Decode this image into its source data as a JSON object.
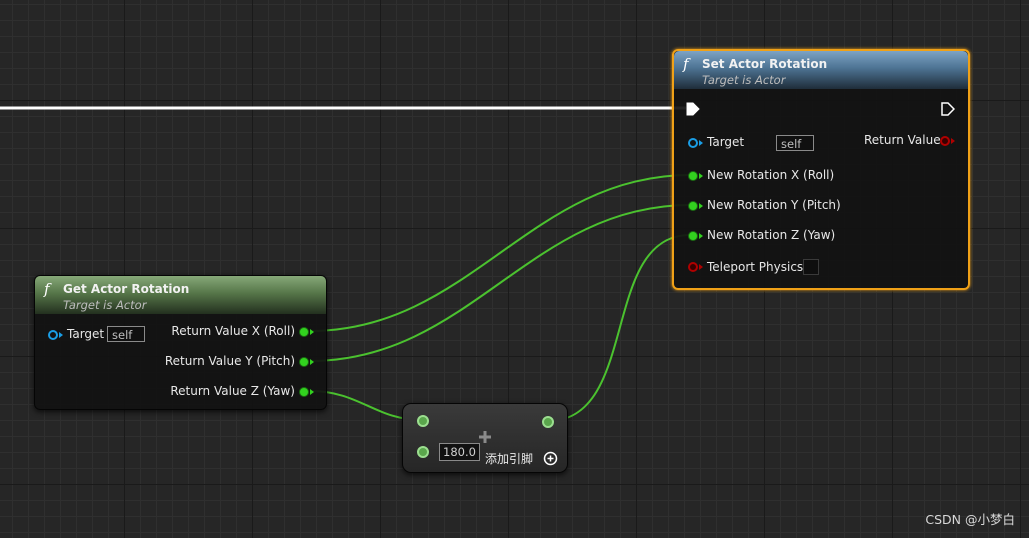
{
  "colors": {
    "exec_wire": "#ffffff",
    "float_wire": "#4bc22f",
    "selection": "#f0a117",
    "float_pin": "#32d21f",
    "object_pin": "#1a9ee6",
    "bool_pin": "#b00000"
  },
  "set_actor_rotation": {
    "icon": "function-icon",
    "title": "Set Actor Rotation",
    "subtitle": "Target is Actor",
    "inputs": {
      "target_label": "Target",
      "target_value": "self",
      "new_x": "New Rotation X (Roll)",
      "new_y": "New Rotation Y (Pitch)",
      "new_z": "New Rotation Z (Yaw)",
      "teleport": "Teleport Physics"
    },
    "outputs": {
      "return_value": "Return Value"
    }
  },
  "get_actor_rotation": {
    "icon": "function-icon",
    "title": "Get Actor Rotation",
    "subtitle": "Target is Actor",
    "inputs": {
      "target_label": "Target",
      "target_value": "self"
    },
    "outputs": {
      "x": "Return Value X (Roll)",
      "y": "Return Value Y (Pitch)",
      "z": "Return Value Z (Yaw)"
    }
  },
  "add_node": {
    "icon": "plus-icon",
    "b_value": "180.0",
    "add_pin_label": "添加引脚",
    "add_pin_icon": "add-circle-icon"
  },
  "watermark": "CSDN @小梦白"
}
